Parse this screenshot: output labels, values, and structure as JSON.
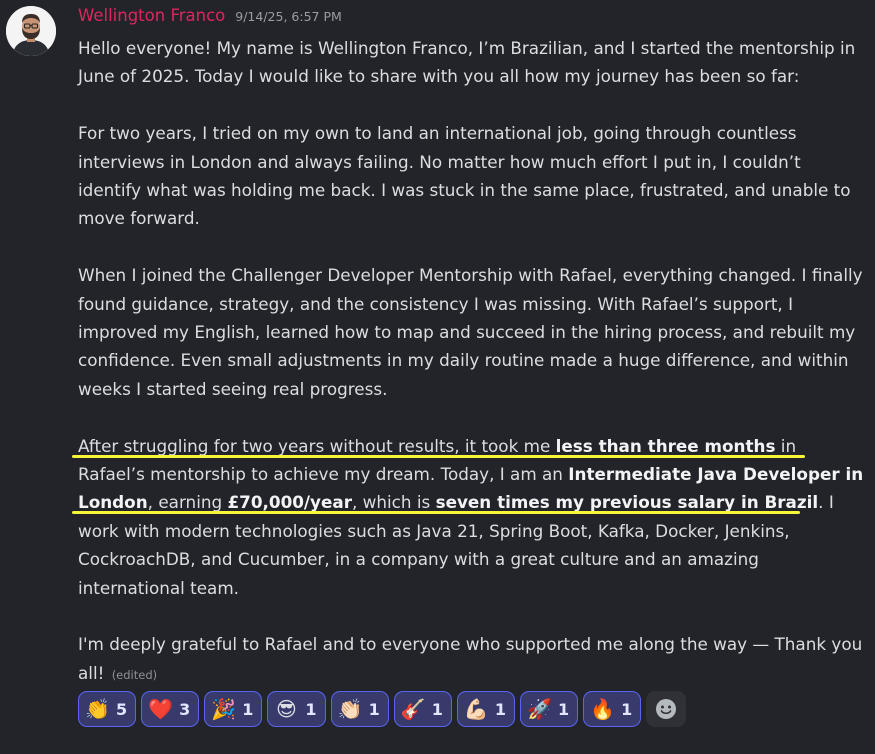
{
  "message": {
    "author": "Wellington Franco",
    "timestamp": "9/14/25, 6:57 PM",
    "p1": "Hello everyone! My name is Wellington Franco, I’m Brazilian, and I started the mentorship in June of 2025. Today I would like to share with you all how my journey has been so far:",
    "p2": "For two years, I tried on my own to land an international job, going through countless interviews in London and always failing. No matter how much effort I put in, I couldn’t identify what was holding me back. I was stuck in the same place, frustrated, and unable to move forward.",
    "p3": "When I joined the Challenger Developer Mentorship with Rafael, everything changed. I finally found guidance, strategy, and the consistency I was missing. With Rafael’s support, I improved my English, learned how to map and succeed in the hiring process, and rebuilt my confidence. Even small adjustments in my daily routine made a huge difference, and within weeks I started seeing real progress.",
    "p4": {
      "t1": "After struggling for two years without results, it took me ",
      "b1": "less than three months",
      "t2": " in Rafael’s mentorship to achieve my dream. Today, I am an ",
      "b2": "Intermediate Java Developer in London",
      "t3": ", earning ",
      "b3": "£70,000/year",
      "t4": ", which is ",
      "b4": "seven times my previous salary in Brazil",
      "t5": ". I work with modern technologies such as Java 21, Spring Boot, Kafka, Docker, Jenkins, CockroachDB, and Cucumber, in a company with a great culture and an amazing international team."
    },
    "p5": "I'm deeply grateful to Rafael and to everyone who supported me along the way — Thank you all!",
    "edited": "(edited)",
    "highlight_color": "#f5f53a"
  },
  "reactions": [
    {
      "emoji": "👏",
      "name": "clapping-hands",
      "count": "5"
    },
    {
      "emoji": "❤️",
      "name": "red-heart",
      "count": "3"
    },
    {
      "emoji": "🎉",
      "name": "party-popper",
      "count": "1"
    },
    {
      "emoji": "😎",
      "name": "sunglasses-face",
      "count": "1"
    },
    {
      "emoji": "👏🏻",
      "name": "clapping-hands-light",
      "count": "1"
    },
    {
      "emoji": "🎸",
      "name": "guitar",
      "count": "1"
    },
    {
      "emoji": "💪🏻",
      "name": "flexed-biceps",
      "count": "1"
    },
    {
      "emoji": "🚀",
      "name": "rocket",
      "count": "1"
    },
    {
      "emoji": "🔥",
      "name": "fire",
      "count": "1"
    }
  ],
  "colors": {
    "background": "#232429",
    "author": "#e0245e",
    "reaction_border": "#5865f2",
    "reaction_bg": "#373a6b"
  }
}
